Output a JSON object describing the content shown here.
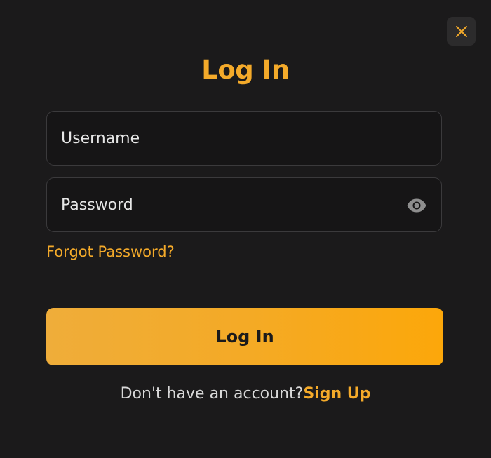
{
  "colors": {
    "accent": "#f4aa2a",
    "background": "#1b1a1b",
    "field_background": "#161516",
    "field_border": "#3b3a3c",
    "button_text": "#1b1a1b",
    "close_icon": "#f4aa2a",
    "eye_icon": "#8e8e8e"
  },
  "modal": {
    "close_icon": "close-icon",
    "title": "Log In"
  },
  "form": {
    "username_placeholder": "Username",
    "password_placeholder": "Password",
    "password_toggle_icon": "eye-icon",
    "forgot_password": "Forgot Password?",
    "submit_label": "Log In"
  },
  "footer": {
    "prompt": "Don't have an account?",
    "signup_link": "Sign Up"
  }
}
